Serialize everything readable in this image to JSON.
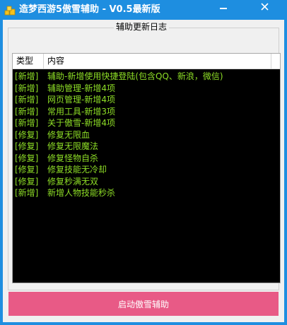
{
  "window": {
    "title": "造梦西游5傲雪辅助 - V0.5最新版",
    "minimize_label": "—",
    "close_label": "✕"
  },
  "group": {
    "title": "辅助更新日志"
  },
  "list": {
    "columns": [
      "类型",
      "内容"
    ],
    "rows": [
      {
        "type": "[新增]",
        "content": "辅助-新增使用快捷登陆(包含QQ、新浪，微信)"
      },
      {
        "type": "[新增]",
        "content": "辅助管理-新增4项"
      },
      {
        "type": "[新增]",
        "content": "网页管理-新增4项"
      },
      {
        "type": "[新增]",
        "content": "常用工具-新增3项"
      },
      {
        "type": "[新增]",
        "content": "关于傲雪-新增4项"
      },
      {
        "type": "[修复]",
        "content": "修复无限血"
      },
      {
        "type": "[修复]",
        "content": "修复无限魔法"
      },
      {
        "type": "[修复]",
        "content": "修复怪物自杀"
      },
      {
        "type": "[修复]",
        "content": "修复技能无冷却"
      },
      {
        "type": "[修复]",
        "content": "修复秒满无双"
      },
      {
        "type": "[新增]",
        "content": "新增人物技能秒杀"
      }
    ]
  },
  "start_button": {
    "label": "启动傲雪辅助"
  },
  "colors": {
    "titlebar": "#1e8ee0",
    "list_background": "#000000",
    "row_text": "#8ede26",
    "button": "#e85a86"
  },
  "icons": {
    "app": "gold-coins-icon",
    "minimize": "minimize-icon",
    "close": "close-icon"
  }
}
